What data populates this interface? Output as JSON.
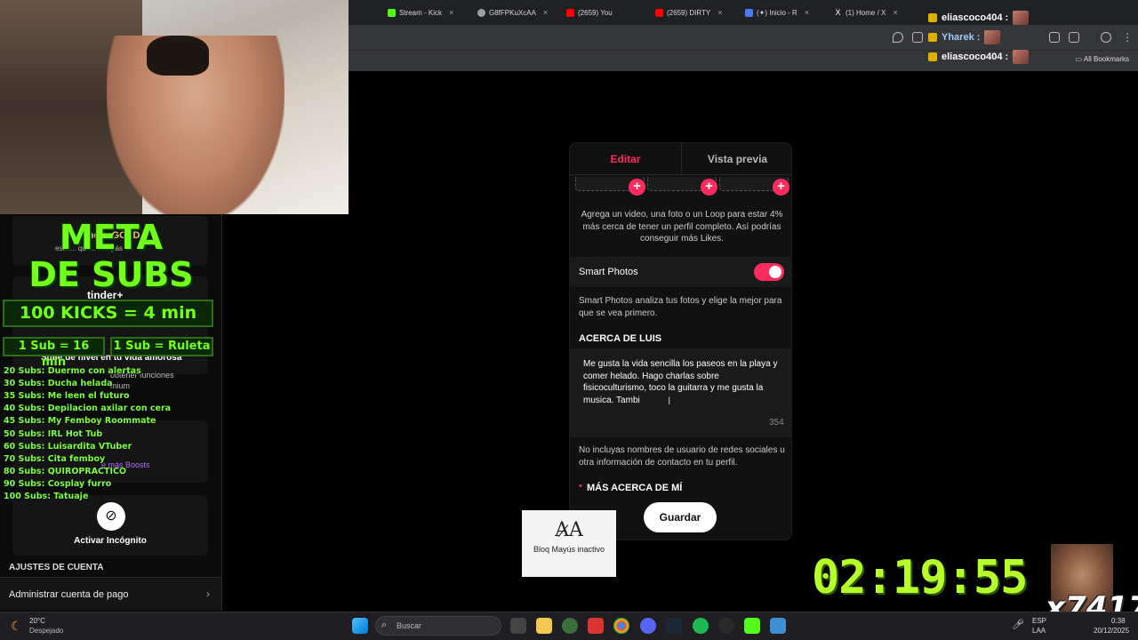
{
  "browser": {
    "tabs": [
      {
        "label": "Stream - Kick",
        "color": "#53fc18"
      },
      {
        "label": "G8fFPKuXcAA",
        "color": "#9aa0a6"
      },
      {
        "label": "(2659) You",
        "color": "#ff0000"
      },
      {
        "label": "(2659) DIRTY",
        "color": "#ff0000"
      },
      {
        "label": "(✦) Inicio - R",
        "color": "#4b7bf5"
      },
      {
        "label": "(1) Home / X",
        "color": "#ffffff"
      }
    ],
    "all_bookmarks": "All Bookmarks"
  },
  "chat": [
    {
      "user": "eliascoco404 :",
      "color": "#ffffff"
    },
    {
      "user": "Yharek :",
      "color": "#ffffff"
    },
    {
      "user": "eliascoco404 :",
      "color": "#ffffff"
    }
  ],
  "overlay": {
    "meta_line1": "META",
    "meta_line2": "DE SUBS",
    "kicks": "100 KICKS = 4 min",
    "sub16": "1 Sub = 16 min",
    "sub_ruleta": "1 Sub = Ruleta",
    "goals": [
      "20 Subs: Duermo con alertas",
      "30 Subs: Ducha helada",
      "35 Subs: Me leen el futuro",
      "40 Subs: Depilacion axilar con cera",
      "45 Subs: My Femboy Roommate",
      "50 Subs: IRL Hot Tub",
      "60 Subs: Luisardita VTuber",
      "70 Subs: Cita femboy",
      "80 Subs: QUIROPRACTICO",
      "90 Subs: Cosplay furro",
      "100 Subs: Tatuaje"
    ],
    "timer": "02:19:55",
    "tag": "x7417"
  },
  "tinder_sidebar": {
    "tinder_gold": "tinder GOLD",
    "tinder_plus": "tinder+",
    "level_up": "Sube de nivel en tu vida amorosa",
    "get_features": "obtener funciones",
    "premium": "mium",
    "boosts": "e más Boosts",
    "incognito": "Activar Incógnito",
    "account_settings": "AJUSTES DE CUENTA",
    "manage_payment": "Administrar cuenta de pago",
    "discover_text": "escu... que... la... pás"
  },
  "editor": {
    "tab_edit": "Editar",
    "tab_preview": "Vista previa",
    "add_media_text": "Agrega un video, una foto o un Loop para estar 4% más cerca de tener un perfil completo. Así podrías conseguir más Likes.",
    "smart_photos_label": "Smart Photos",
    "smart_photos_desc": "Smart Photos analiza tus fotos y elige la mejor para que se vea primero.",
    "about_header": "ACERCA DE LUIS",
    "about_text": "Me gusta la vida sencilla los paseos en la playa y comer helado. Hago charlas sobre fisicoculturismo, toco la guitarra y me gusta la musica. Tambi",
    "char_count": "354",
    "no_contact_note": "No incluyas nombres de usuario de redes sociales u otra información de contacto en tu perfil.",
    "more_about_header": "MÁS ACERCA DE MÍ",
    "save_button": "Guardar"
  },
  "caps_lock": {
    "label": "Bloq Mayús inactivo"
  },
  "taskbar": {
    "weather_temp": "20°C",
    "weather_desc": "Despejado",
    "search_placeholder": "Buscar",
    "lang": "ESP",
    "lang2": "LAA",
    "time": "0:38",
    "date": "20/12/2025"
  },
  "colors": {
    "tinder_accent": "#fd2b5f",
    "overlay_green": "#72ff1a",
    "timer_green": "#b7ff2a"
  }
}
